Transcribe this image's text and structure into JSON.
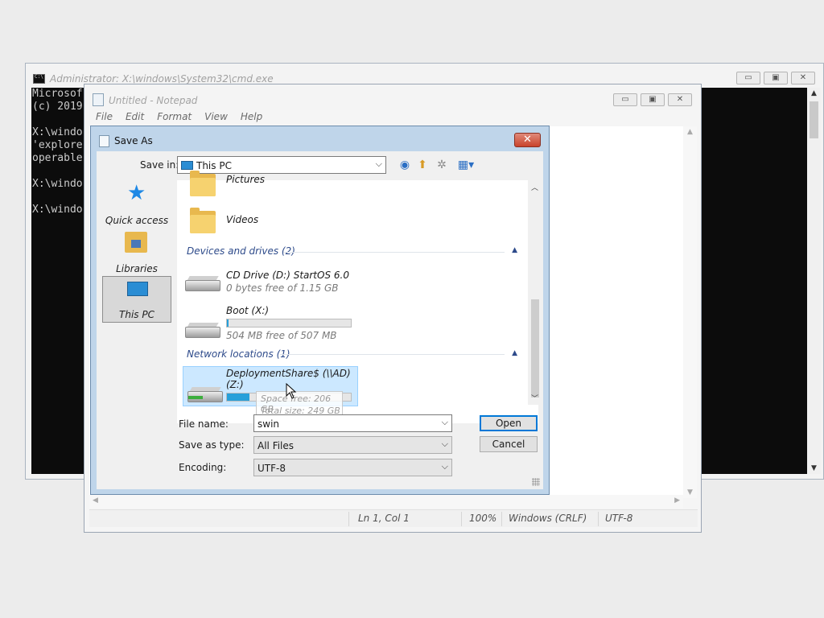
{
  "cmd": {
    "title": "Administrator: X:\\windows\\System32\\cmd.exe",
    "lines": [
      "Microsof",
      "(c) 2019",
      "",
      "X:\\windo",
      "'explore",
      "operable",
      "",
      "X:\\windo",
      "",
      "X:\\windo"
    ],
    "minimize_label": "▭",
    "maximize_label": "▣",
    "close_label": "✕"
  },
  "notepad": {
    "title": "Untitled - Notepad",
    "menu": [
      "File",
      "Edit",
      "Format",
      "View",
      "Help"
    ],
    "status": {
      "position": "Ln 1, Col 1",
      "zoom": "100%",
      "line_ending": "Windows (CRLF)",
      "encoding": "UTF-8"
    },
    "minimize_label": "▭",
    "maximize_label": "▣",
    "close_label": "✕"
  },
  "dialog": {
    "title": "Save As",
    "close_label": "✕",
    "save_in_label": "Save in:",
    "save_in_value": "This PC",
    "places": [
      {
        "label": "Quick access",
        "icon": "star-icon"
      },
      {
        "label": "Libraries",
        "icon": "libraries-icon"
      },
      {
        "label": "This PC",
        "icon": "this-pc-icon"
      }
    ],
    "list": {
      "partial_item": "Pictures",
      "videos": "Videos",
      "devices_header": "Devices and drives (2)",
      "drives": [
        {
          "name": "CD Drive (D:) StartOS 6.0",
          "free": "0 bytes free of 1.15 GB"
        },
        {
          "name": "Boot (X:)",
          "free": "504 MB free of 507 MB",
          "used_fraction": 0.01
        }
      ],
      "network_header": "Network locations (1)",
      "network": [
        {
          "name": "DeploymentShare$ (\\\\AD)",
          "name2": "(Z:)",
          "used_fraction": 0.18
        }
      ],
      "tooltip": {
        "space_free": "Space free: 206 GB",
        "total_size": "Total size: 249 GB"
      }
    },
    "file_name_label": "File name:",
    "file_name_value": "swin",
    "save_type_label": "Save as type:",
    "save_type_value": "All Files",
    "encoding_label": "Encoding:",
    "encoding_value": "UTF-8",
    "open_label": "Open",
    "cancel_label": "Cancel"
  }
}
